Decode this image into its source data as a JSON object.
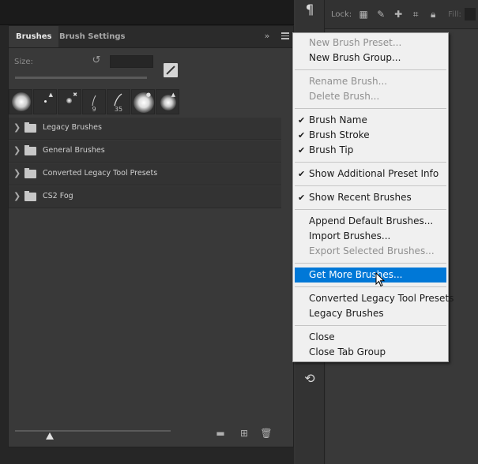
{
  "options_bar": {
    "lock_label": "Lock:",
    "fill_label": "Fill:",
    "icons": [
      "checkerboard-lock-icon",
      "brush-lock-icon",
      "move-lock-icon",
      "artboard-lock-icon",
      "padlock-icon"
    ]
  },
  "dock": {
    "paragraph_icon": "¶"
  },
  "brushes_panel": {
    "tabs": [
      "Brushes",
      "Brush Settings"
    ],
    "active_tab": "Brushes",
    "size_label": "Size:",
    "size_value": "",
    "recent_brushes": [
      {
        "type": "soft-round",
        "label": ""
      },
      {
        "type": "small-hard",
        "label": ""
      },
      {
        "type": "small-soft",
        "label": ""
      },
      {
        "type": "stroke",
        "label": "9"
      },
      {
        "type": "stroke",
        "label": "35"
      },
      {
        "type": "soft-round",
        "label": ""
      },
      {
        "type": "soft-round",
        "label": ""
      }
    ],
    "groups": [
      "Legacy Brushes",
      "General Brushes",
      "Converted Legacy Tool Presets",
      "CS2 Fog"
    ]
  },
  "menu": {
    "items": [
      {
        "label": "New Brush Preset...",
        "disabled": true,
        "checked": false,
        "highlighted": false
      },
      {
        "label": "New Brush Group...",
        "disabled": false,
        "checked": false,
        "highlighted": false
      },
      {
        "label": "Rename Brush...",
        "disabled": true,
        "checked": false,
        "highlighted": false
      },
      {
        "label": "Delete Brush...",
        "disabled": true,
        "checked": false,
        "highlighted": false
      },
      {
        "label": "Brush Name",
        "disabled": false,
        "checked": true,
        "highlighted": false
      },
      {
        "label": "Brush Stroke",
        "disabled": false,
        "checked": true,
        "highlighted": false
      },
      {
        "label": "Brush Tip",
        "disabled": false,
        "checked": true,
        "highlighted": false
      },
      {
        "label": "Show Additional Preset Info",
        "disabled": false,
        "checked": true,
        "highlighted": false
      },
      {
        "label": "Show Recent Brushes",
        "disabled": false,
        "checked": true,
        "highlighted": false
      },
      {
        "label": "Append Default Brushes...",
        "disabled": false,
        "checked": false,
        "highlighted": false
      },
      {
        "label": "Import Brushes...",
        "disabled": false,
        "checked": false,
        "highlighted": false
      },
      {
        "label": "Export Selected Brushes...",
        "disabled": true,
        "checked": false,
        "highlighted": false
      },
      {
        "label": "Get More Brushes...",
        "disabled": false,
        "checked": false,
        "highlighted": true
      },
      {
        "label": "Converted Legacy Tool Presets",
        "disabled": false,
        "checked": false,
        "highlighted": false
      },
      {
        "label": "Legacy Brushes",
        "disabled": false,
        "checked": false,
        "highlighted": false
      },
      {
        "label": "Close",
        "disabled": false,
        "checked": false,
        "highlighted": false
      },
      {
        "label": "Close Tab Group",
        "disabled": false,
        "checked": false,
        "highlighted": false
      }
    ],
    "highlight_color": "#0078d7"
  }
}
